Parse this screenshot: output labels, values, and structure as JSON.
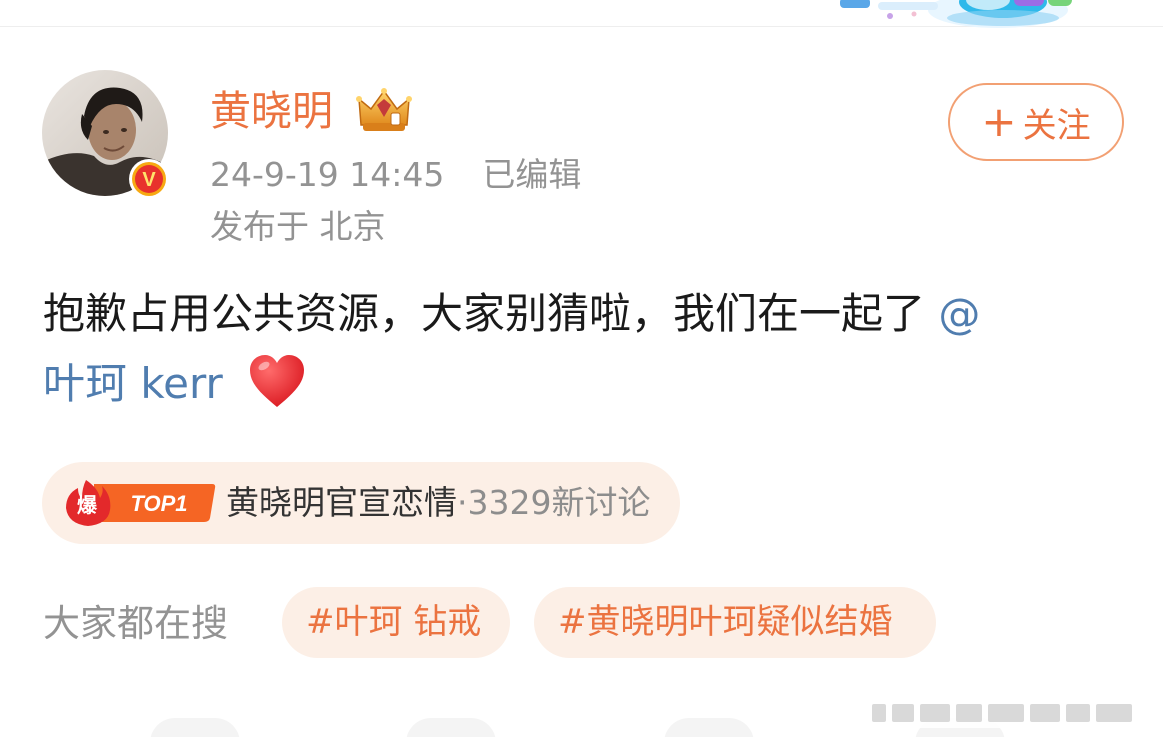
{
  "post": {
    "author": {
      "name": "黄晓明",
      "verified_badge": "V"
    },
    "meta": {
      "date_time": "24-9-19 14:45",
      "edited_label": "已编辑",
      "location": "发布于 北京"
    },
    "follow_button": {
      "icon": "plus-icon",
      "plus": "+",
      "label": "关注"
    },
    "text": {
      "line1_body": "抱歉占用公共资源，大家别猜啦，我们在一起了",
      "line1_mention_start": "@",
      "line2_mention_rest": "叶珂 kerr",
      "emoji": "heart-icon"
    },
    "hot_topic": {
      "badge_glyph": "爆",
      "badge_text": "TOP1",
      "title": "黄晓明官宣恋情",
      "count": "·3329新讨论"
    },
    "search": {
      "label": "大家都在搜",
      "chips": [
        "#叶珂 钻戒",
        "#黄晓明叶珂疑似结婚"
      ]
    }
  },
  "colors": {
    "accent_orange": "#eb7340",
    "mention_blue": "#507daf",
    "meta_gray": "#939393",
    "chip_background": "#fcefe6",
    "hot_red": "#e3292b"
  }
}
